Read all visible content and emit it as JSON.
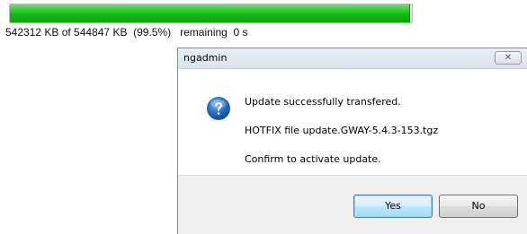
{
  "progress": {
    "fraction": 0.995,
    "status_text": "542312 KB of 544847 KB  (99.5%)   remaining  0 s",
    "fill_color": "#1fbf1f"
  },
  "dialog": {
    "title": "ngadmin",
    "close_glyph": "✕",
    "icon": "question-icon",
    "lines": [
      "Update successfully transfered.",
      "HOTFIX file update.GWAY-5.4.3-153.tgz",
      "Confirm to activate update."
    ],
    "buttons": {
      "yes": "Yes",
      "no": "No"
    }
  }
}
